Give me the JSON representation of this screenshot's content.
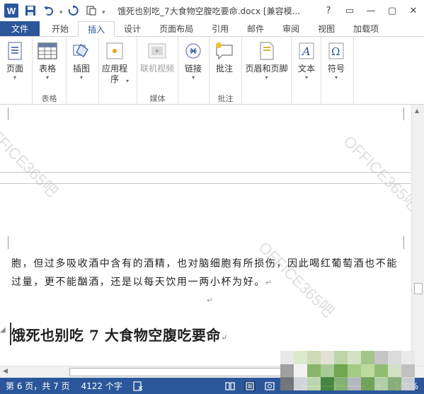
{
  "title_bar": {
    "app_icon": "word-icon",
    "app_letter": "W",
    "document_title": "饿死也别吃_7大食物空腹吃要命.docx [兼容模...",
    "window_buttons": [
      "?",
      "▭",
      "—",
      "▢",
      "✕"
    ]
  },
  "tabs": [
    {
      "label": "文件",
      "active": false,
      "file": true
    },
    {
      "label": "开始",
      "active": false
    },
    {
      "label": "插入",
      "active": true
    },
    {
      "label": "设计",
      "active": false
    },
    {
      "label": "页面布局",
      "active": false
    },
    {
      "label": "引用",
      "active": false
    },
    {
      "label": "邮件",
      "active": false
    },
    {
      "label": "审阅",
      "active": false
    },
    {
      "label": "视图",
      "active": false
    },
    {
      "label": "加载项",
      "active": false
    }
  ],
  "ribbon": {
    "groups": [
      {
        "label": "",
        "buttons": [
          {
            "label": "页面",
            "icon": "page-icon",
            "enabled": true
          }
        ]
      },
      {
        "label": "表格",
        "buttons": [
          {
            "label": "表格",
            "icon": "table-icon",
            "enabled": true
          }
        ]
      },
      {
        "label": "",
        "buttons": [
          {
            "label": "插图",
            "icon": "illustration-icon",
            "enabled": true
          }
        ]
      },
      {
        "label": "",
        "buttons": [
          {
            "label": "应用程\n序",
            "icon": "apps-icon",
            "enabled": true
          }
        ]
      },
      {
        "label": "媒体",
        "buttons": [
          {
            "label": "联机视频",
            "icon": "video-icon",
            "enabled": false
          }
        ]
      },
      {
        "label": "",
        "buttons": [
          {
            "label": "链接",
            "icon": "link-icon",
            "enabled": true
          }
        ]
      },
      {
        "label": "批注",
        "buttons": [
          {
            "label": "批注",
            "icon": "comment-icon",
            "enabled": true
          }
        ]
      },
      {
        "label": "",
        "buttons": [
          {
            "label": "页眉和页脚",
            "icon": "header-footer-icon",
            "enabled": true
          }
        ]
      },
      {
        "label": "",
        "buttons": [
          {
            "label": "文本",
            "icon": "text-icon",
            "enabled": true
          }
        ]
      },
      {
        "label": "",
        "buttons": [
          {
            "label": "符号",
            "icon": "symbol-icon",
            "enabled": true
          }
        ]
      }
    ]
  },
  "document": {
    "body_paragraph": "胞，但过多吸收酒中含有的酒精，也对脑细胞有所损伤，因此喝红葡萄酒也不能过量，更不能酗酒，还是以每天饮用一两小杯为好。",
    "paragraph_mark": "↵",
    "heading": "饿死也别吃 7 大食物空腹吃要命",
    "watermark": "OFFICE365吧"
  },
  "status_bar": {
    "page_info": "第 6 页，共 7 页",
    "word_count": "4122 个字",
    "zoom": "100%",
    "zoom_level_percent": 100
  },
  "colors": {
    "accent": "#2b579a",
    "status_bg": "#2b579a"
  }
}
